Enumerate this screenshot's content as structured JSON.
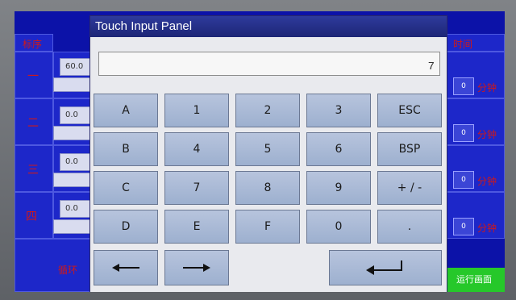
{
  "panel": {
    "title": "Touch Input Panel",
    "display_value": "7"
  },
  "keys": {
    "a": "A",
    "one": "1",
    "two": "2",
    "three": "3",
    "esc": "ESC",
    "b": "B",
    "four": "4",
    "five": "5",
    "six": "6",
    "bsp": "BSP",
    "c": "C",
    "seven": "7",
    "eight": "8",
    "nine": "9",
    "plus_minus": "+ / -",
    "d": "D",
    "e": "E",
    "f": "F",
    "zero": "0",
    "dot": "."
  },
  "icons": {
    "left": "arrow-left-icon",
    "right": "arrow-right-icon",
    "enter": "enter-icon"
  },
  "background": {
    "header_left": "标序",
    "header_right": "时间",
    "stage_labels": [
      "一",
      "二",
      "三",
      "四"
    ],
    "setpoints": [
      "60.0",
      "0.0",
      "0.0",
      "0.0"
    ],
    "minute_values": [
      "0",
      "0",
      "0",
      "0"
    ],
    "minute_unit": "分钟",
    "loop_label": "循环",
    "run_button": "运行画面"
  },
  "colors": {
    "screen": "#0c12a8",
    "titlebar": "#1d2676",
    "key": "#a9b9d6",
    "run_button": "#26c82a"
  }
}
